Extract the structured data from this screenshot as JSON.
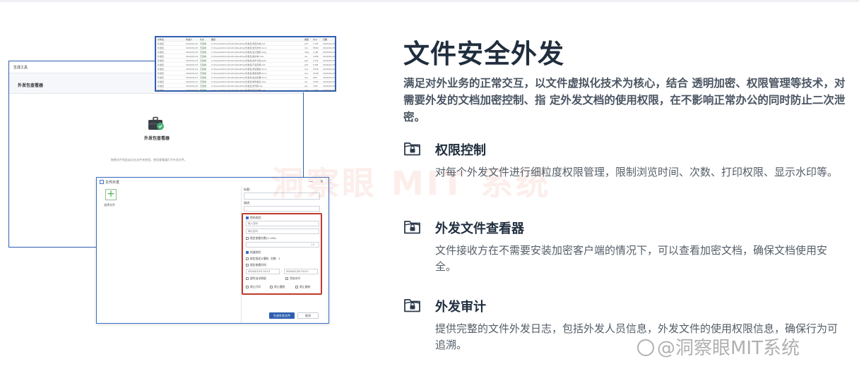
{
  "screenshot": {
    "main_window": {
      "title": "生成工具",
      "subbar_label": "外发包查看器",
      "center_label": "外发包查看器",
      "hint": "拖拽文件到此或点击文件夹按钮，使用查看器打开外发文件。"
    },
    "list_window": {
      "header": [
        "文件名",
        "外发人",
        "状态",
        "路径",
        "类型",
        "大小",
        "日期"
      ],
      "rows": [
        [
          "外发包",
          "2024/01/15",
          "已完成",
          "C:/Users/Administrator/Desktop/外发包/项目文档.pdf",
          "pdf",
          "1.2M",
          "2024/01/15"
        ],
        [
          "外发包",
          "2024/01/15",
          "已完成",
          "C:/Users/Administrator/Desktop/外发包/合同文件.docx",
          "doc",
          "856K",
          "2024/01/15"
        ],
        [
          "外发包",
          "2024/01/14",
          "已完成",
          "C:/Users/Administrator/Desktop/外发包/设计图纸.dwg",
          "dwg",
          "3.4M",
          "2024/01/14"
        ],
        [
          "外发包",
          "2024/01/14",
          "已完成",
          "C:/Users/Administrator/Desktop/外发包/报价单.xlsx",
          "xls",
          "128K",
          "2024/01/14"
        ],
        [
          "外发包",
          "2024/01/13",
          "已完成",
          "C:/Users/Administrator/Desktop/外发包/技术方案.pptx",
          "ppt",
          "2.1M",
          "2024/01/13"
        ],
        [
          "外发包",
          "2024/01/13",
          "已完成",
          "C:/Users/Administrator/Desktop/外发包/产品手册.pdf",
          "pdf",
          "5.6M",
          "2024/01/13"
        ],
        [
          "外发包",
          "2024/01/12",
          "已完成",
          "C:/Users/Administrator/Desktop/外发包/测试报告.docx",
          "doc",
          "432K",
          "2024/01/12"
        ],
        [
          "外发包",
          "2024/01/12",
          "已完成",
          "C:/Users/Administrator/Desktop/外发包/需求说明.docx",
          "doc",
          "318K",
          "2024/01/12"
        ],
        [
          "外发包",
          "2024/01/11",
          "已完成",
          "C:/Users/Administrator/Desktop/外发包/会议纪要.docx",
          "doc",
          "96K",
          "2024/01/11"
        ],
        [
          "外发包",
          "2024/01/11",
          "已完成",
          "C:/Users/Administrator/Desktop/外发包/财务报表.xlsx",
          "xls",
          "764K",
          "2024/01/11"
        ],
        [
          "外发包",
          "2024/01/10",
          "已完成",
          "C:/Users/Administrator/Desktop/外发包/源代码.zip",
          "zip",
          "12M",
          "2024/01/10"
        ],
        [
          "外发包",
          "2024/01/10",
          "已完成",
          "C:/Users/Administrator/Desktop/外发包/接口文档.pdf",
          "pdf",
          "1.8M",
          "2024/01/10"
        ]
      ]
    },
    "dialog": {
      "title": "文件外发",
      "close": "✕",
      "minimize": "—",
      "add_file_label": "选择文件",
      "field_title_label": "标题：",
      "field_desc_label": "描述：",
      "password_label": "密码校验：",
      "password_placeholder": "输入密码",
      "confirm_placeholder": "确认密码",
      "limit_views_label": "限定查看次数(1-100)",
      "limit_views_value": "10",
      "checks": {
        "machine_verify": "机器校验",
        "bind_machine": "绑定指定计算机",
        "bind_machine_count": "台数：1",
        "limit_time": "限定查看时间",
        "auto_destroy": "超时自动销毁",
        "watermark": "添加水印",
        "no_print": "禁止打印",
        "no_screenshot": "禁止截图",
        "no_copy": "禁止复制"
      },
      "date_start": "2024/01/15 10:11",
      "date_end": "2024/01/20 10:11",
      "date_sep": "-",
      "btn_generate": "生成外发文件",
      "btn_cancel": "取消"
    }
  },
  "center_watermark": "洞察眼 MIT 系统",
  "content": {
    "title": "文件安全外发",
    "intro": "满足对外业务的正常交互，以文件虚拟化技术为核心，结合 透明加密、权限管理等技术，对需要外发的文档加密控制、指 定外发文档的使用权限，在不影响正常办公的同时防止二次泄 密。",
    "features": [
      {
        "icon": "folder-lock-icon",
        "title": "权限控制",
        "desc": "对每个外发文件进行细粒度权限管理，限制浏览时间、次数、打印权限、显示水印等。"
      },
      {
        "icon": "folder-lock-icon",
        "title": "外发文件查看器",
        "desc": "文件接收方在不需要安装加密客户端的情况下，可以查看加密文档，确保文档使用安全。"
      },
      {
        "icon": "folder-lock-icon",
        "title": "外发审计",
        "desc": "提供完整的文件外发日志，包括外发人员信息，外发文件的使用权限信息，确保行为可追溯。"
      }
    ]
  },
  "corner_watermark": "@洞察眼MIT系统",
  "colors": {
    "accent_blue": "#2f5fb0",
    "highlight_red": "#c0392b",
    "title_dark": "#1f2d3d",
    "icon_stroke": "#2b3a4a"
  }
}
